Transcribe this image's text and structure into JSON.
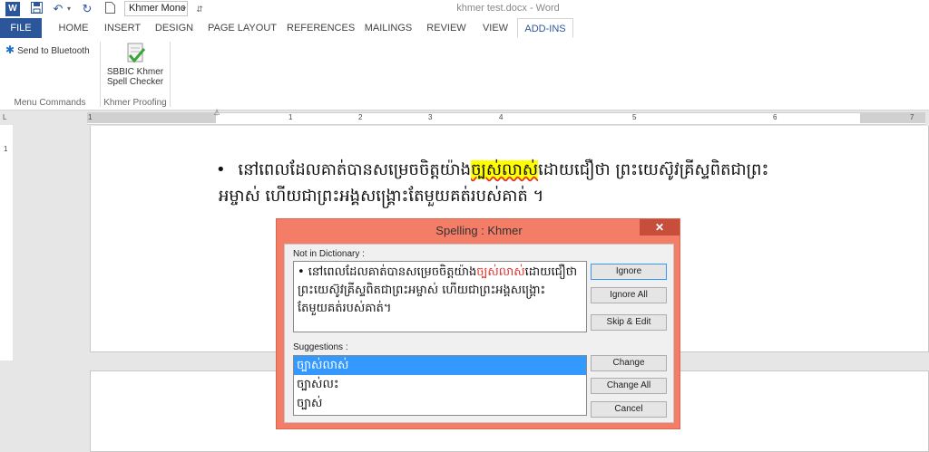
{
  "titlebar": {
    "font_name": "Khmer Monc",
    "document_title": "khmer test.docx - Word"
  },
  "ribbon": {
    "tabs": [
      {
        "label": "FILE"
      },
      {
        "label": "HOME"
      },
      {
        "label": "INSERT"
      },
      {
        "label": "DESIGN"
      },
      {
        "label": "PAGE LAYOUT"
      },
      {
        "label": "REFERENCES"
      },
      {
        "label": "MAILINGS"
      },
      {
        "label": "REVIEW"
      },
      {
        "label": "VIEW"
      },
      {
        "label": "ADD-INS"
      }
    ],
    "menu_commands": {
      "send_bluetooth": "Send to Bluetooth",
      "group_label": "Menu Commands"
    },
    "khmer_proofing": {
      "checker_line1": "SBBIC Khmer",
      "checker_line2": "Spell Checker",
      "group_label": "Khmer Proofing"
    }
  },
  "ruler": {
    "ticks": [
      "1",
      "1",
      "2",
      "3",
      "4",
      "5",
      "6",
      "7"
    ]
  },
  "document": {
    "bullet": "•",
    "line1_before": "នៅពេលដែលគាត់បានសម្រេចចិត្តយ៉ាង",
    "line1_error": "ច្បស់លាស់",
    "line1_after": "ដោយជឿថា  ព្រះយេស៊ូវគ្រីស្ទពិតជាព្រះ",
    "line2": "អម្ចាស់  ហើយជាព្រះអង្គសង្គ្រោះតែមួយគត់របស់គាត់ ។"
  },
  "dialog": {
    "title": "Spelling : Khmer",
    "close_label": "✕",
    "not_in_dictionary_label": "Not in Dictionary :",
    "context_before": "• នៅពេលដែលគាត់បានសម្រេចចិត្តយ៉ាង",
    "context_error": "ច្បស់លាស់",
    "context_after": "ដោយជឿថា ព្រះយេស៊ូវគ្រីស្ទពិតជាព្រះអម្ចាស់ ហើយជាព្រះអង្គសង្គ្រោះតែមួយគត់របស់គាត់។",
    "suggestions_label": "Suggestions :",
    "suggestions": [
      "ច្បាស់លាស់",
      "ច្បាស់លះ",
      "ច្បាស់"
    ],
    "buttons": {
      "ignore": "Ignore",
      "ignore_all": "Ignore All",
      "skip_edit": "Skip & Edit",
      "change": "Change",
      "change_all": "Change All",
      "cancel": "Cancel"
    }
  },
  "colors": {
    "word_blue": "#2b579a",
    "dialog_frame": "#f37d66",
    "highlight": "#ffff00",
    "error_red": "#e0322e",
    "selection": "#3399ff"
  }
}
